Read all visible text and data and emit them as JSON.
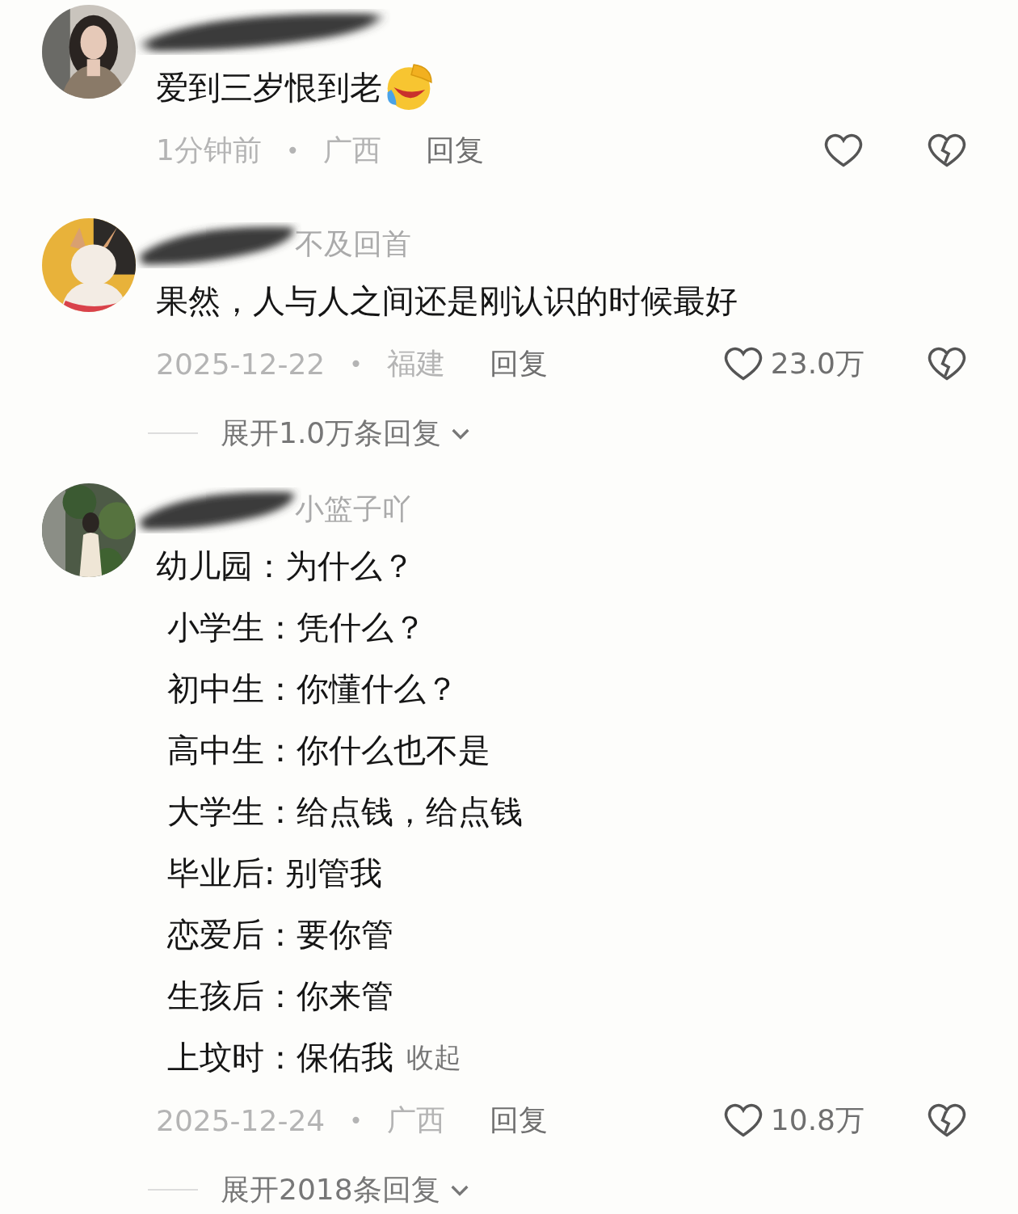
{
  "comments": [
    {
      "text_lines": [
        "爱到三岁恨到老"
      ],
      "emoji": true,
      "time": "1分钟前",
      "separator": "•",
      "region": "广西",
      "reply_label": "回复"
    },
    {
      "author": "不及回首",
      "text_lines": [
        "果然，人与人之间还是刚认识的时候最好"
      ],
      "emoji": false,
      "time": "2025-12-22",
      "separator": "•",
      "region": "福建",
      "reply_label": "回复",
      "likes": "23.0万",
      "expand_label": "展开1.0万条回复"
    },
    {
      "author": "小篮子吖",
      "text_lines": [
        "幼儿园：为什么？",
        "小学生：凭什么？",
        "初中生：你懂什么？",
        "高中生：你什么也不是",
        "大学生：给点钱，给点钱",
        "毕业后: 别管我",
        "恋爱后：要你管",
        "生孩后：你来管",
        "上坟时：保佑我"
      ],
      "emoji": false,
      "time": "2025-12-24",
      "separator": "•",
      "region": "广西",
      "reply_label": "回复",
      "likes": "10.8万",
      "collapse_label": "收起",
      "expand_label": "展开2018条回复"
    }
  ]
}
